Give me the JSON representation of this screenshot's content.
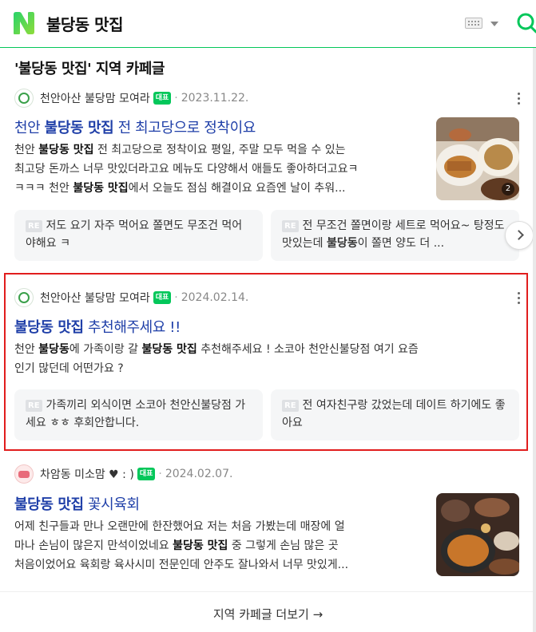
{
  "search": {
    "query": "불당동 맛집"
  },
  "section": {
    "title": "'불당동 맛집' 지역 카페글",
    "more_link": "지역 카페글 더보기 →"
  },
  "posts": [
    {
      "cafe": "천안아산 불당맘 모여라",
      "badge": "대표",
      "date": "2023.11.22.",
      "title_pre": "천안 ",
      "title_bold": "불당동 맛집",
      "title_post": " 전 최고당으로 정착이요",
      "snippet": [
        [
          "천안 ",
          "불당동 맛집",
          " 전 최고당으로 정착이요 평일, 주말 모두 먹을 수 있는"
        ],
        [
          "최고당 돈까스 너무 맛있더라고요 메뉴도 다양해서 애들도 좋아하더고요ㅋ",
          "",
          ""
        ],
        [
          "ㅋㅋㅋ 천안 ",
          "불당동 맛집",
          "에서 오늘도 점심 해결이요 요즘엔 날이 추워..."
        ]
      ],
      "thumb_count": "2",
      "replies": [
        {
          "tag": "RE",
          "pre": "저도 요기 자주 먹어요 쫄면도 무조건 먹어야해요 ㅋ",
          "bold": "",
          "post": ""
        },
        {
          "tag": "RE",
          "pre": "전 무조건 쫄면이랑 세트로 먹어요~ 탕정도 맛있는데 ",
          "bold": "불당동",
          "post": "이 쫄면 양도 더 ..."
        }
      ]
    },
    {
      "cafe": "천안아산 불당맘 모여라",
      "badge": "대표",
      "date": "2024.02.14.",
      "title_pre": "",
      "title_bold": "불당동 맛집",
      "title_post": " 추천해주세요 !!",
      "snippet": [
        [
          "천안 ",
          "불당동",
          "에 가족이랑 갈 "
        ],
        [
          "",
          "불당동 맛집",
          " 추천해주세요 ! 소코아 천안신불당점 여기 요즘"
        ],
        [
          "인기 많던데 어떤가요 ?",
          "",
          ""
        ]
      ],
      "replies": [
        {
          "tag": "RE",
          "pre": "가족끼리 외식이면 소코아 천안신불당점 가세요 ㅎㅎ 후회안합니다.",
          "bold": "",
          "post": ""
        },
        {
          "tag": "RE",
          "pre": "전 여자친구랑 갔었는데 데이트 하기에도 좋아요",
          "bold": "",
          "post": ""
        }
      ]
    },
    {
      "cafe": "차암동 미소맘 ♥ : )",
      "badge": "대표",
      "date": "2024.02.07.",
      "title_pre": "",
      "title_bold": "불당동 맛집",
      "title_post": " 꽃시육회",
      "snippet": [
        [
          "어제 친구들과 만나 오랜만에 한잔했어요 저는 처음 가봤는데 매장에 얼",
          "",
          ""
        ],
        [
          "마나 손님이 많은지 만석이었네요 ",
          "불당동 맛집",
          " 중 그렇게 손님 많은 곳"
        ],
        [
          "처음이었어요 육회랑 육사시미 전문인데 안주도 잘나와서 너무 맛있게...",
          "",
          ""
        ]
      ]
    }
  ],
  "colors": {
    "brand": "#03c75a",
    "title_link": "#1f3fa8",
    "highlight_border": "#e11d1d"
  }
}
